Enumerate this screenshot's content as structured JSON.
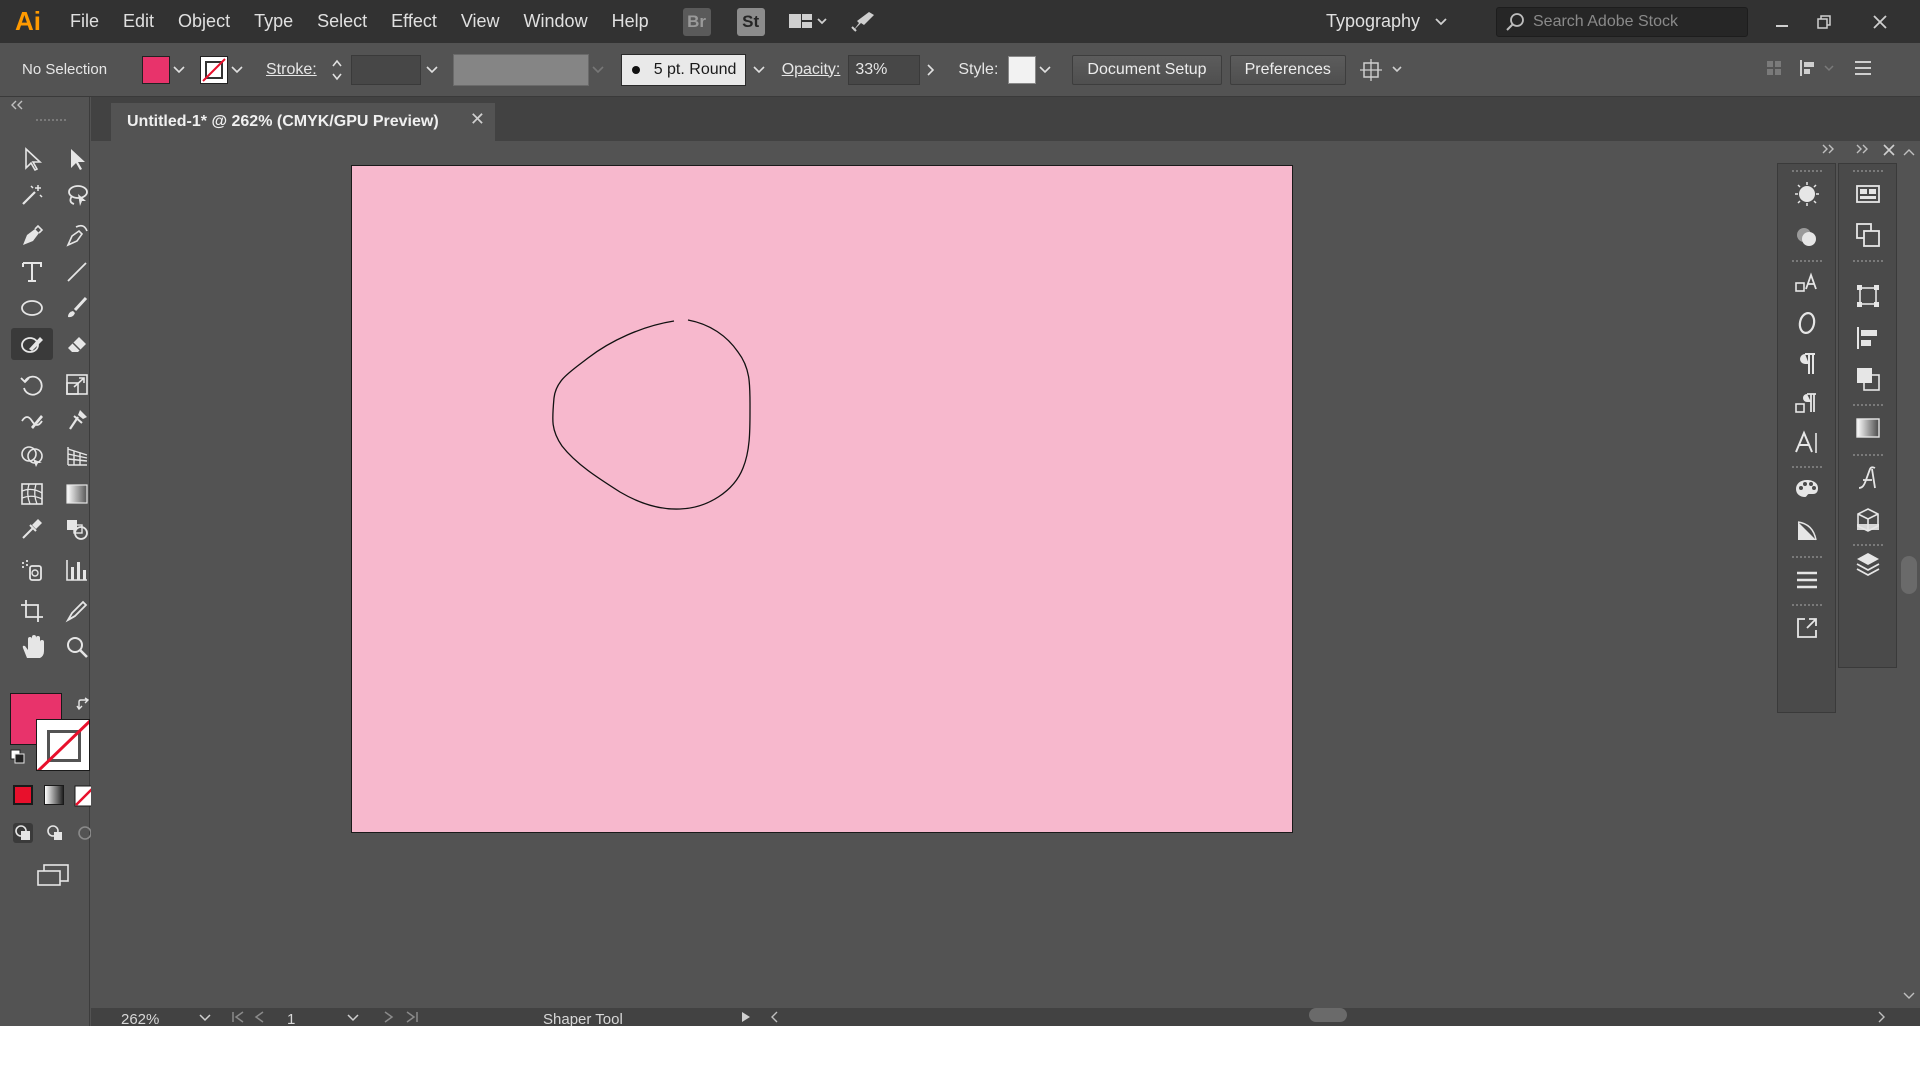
{
  "app": {
    "logo": "Ai",
    "menu": [
      "File",
      "Edit",
      "Object",
      "Type",
      "Select",
      "Effect",
      "View",
      "Window",
      "Help"
    ],
    "badges": {
      "bridge": "Br",
      "stock": "St"
    },
    "workspace": "Typography",
    "search_placeholder": "Search Adobe Stock"
  },
  "control_bar": {
    "selection": "No Selection",
    "fill_color": "#e8336b",
    "stroke_label": "Stroke:",
    "brush": "5 pt. Round",
    "opacity_label": "Opacity:",
    "opacity_value": "33%",
    "style_label": "Style:",
    "document_setup": "Document Setup",
    "preferences": "Preferences"
  },
  "document": {
    "tab_title": "Untitled-1* @ 262% (CMYK/GPU Preview)",
    "artboard_color": "#f7b8cd"
  },
  "toolbar": {
    "fill_color": "#e8336b",
    "active_tool": "shaper-tool"
  },
  "status": {
    "zoom": "262%",
    "artboard_number": "1",
    "current_tool": "Shaper Tool"
  },
  "icons": {
    "tools": [
      "selection-tool-icon",
      "direct-selection-tool-icon",
      "magic-wand-icon",
      "lasso-icon",
      "pen-tool-icon",
      "curvature-tool-icon",
      "type-tool-icon",
      "line-tool-icon",
      "ellipse-tool-icon",
      "paintbrush-icon",
      "shaper-tool-icon",
      "eraser-icon",
      "rotate-tool-icon",
      "scale-tool-icon",
      "warp-tool-icon",
      "puppet-warp-icon",
      "shape-builder-icon",
      "perspective-grid-icon",
      "mesh-tool-icon",
      "gradient-tool-icon",
      "eyedropper-icon",
      "blend-tool-icon",
      "symbol-sprayer-icon",
      "column-graph-icon",
      "artboard-tool-icon",
      "slice-tool-icon",
      "hand-tool-icon",
      "zoom-tool-icon"
    ]
  }
}
